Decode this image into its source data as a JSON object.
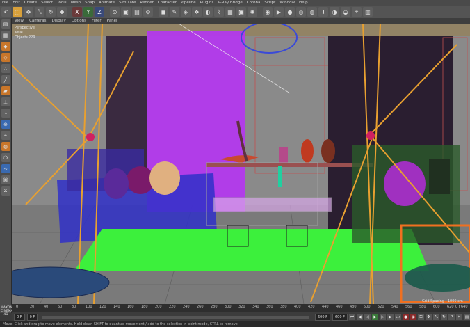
{
  "menu": [
    "File",
    "Edit",
    "Create",
    "Select",
    "Tools",
    "Mesh",
    "Snap",
    "Animate",
    "Simulate",
    "Render",
    "Character",
    "Pipeline",
    "Plugins",
    "V-Ray Bridge",
    "Corona",
    "Script",
    "Window",
    "Help"
  ],
  "toolbar": {
    "icons": [
      "undo-icon",
      "select-icon",
      "move-icon",
      "scale-icon",
      "rotate-icon",
      "add-icon"
    ],
    "axis": [
      "X",
      "Y",
      "Z"
    ]
  },
  "viewport_menu": [
    "View",
    "Cameras",
    "Display",
    "Options",
    "Filter",
    "Panel"
  ],
  "viewport_info": {
    "view_label": "Perspective",
    "total_label": "Total",
    "objects_label": "Objects",
    "objects_count": "229"
  },
  "timeline": {
    "ticks": [
      "0",
      "20",
      "40",
      "60",
      "80",
      "100",
      "120",
      "140",
      "160",
      "180",
      "200",
      "220",
      "240",
      "260",
      "280",
      "300",
      "320",
      "340",
      "360",
      "380",
      "400",
      "420",
      "440",
      "460",
      "480",
      "500",
      "520",
      "540",
      "560",
      "580",
      "600",
      "620",
      "640"
    ],
    "current_frame": "0 F",
    "grid_spacing": "Grid Spacing : 1000 cm"
  },
  "playback": {
    "start": "0 F",
    "min": "0 F",
    "max": "600 F",
    "end": "600 F"
  },
  "logo": {
    "line1": "MAXON",
    "line2": "CINEMA 4D"
  },
  "status": "Move: Click and drag to move elements. Hold down SHIFT to quantize movement / add to the selection in point mode, CTRL to remove.",
  "colors": {
    "wire_purple": "#b436f0",
    "wire_green": "#3cf03c",
    "wire_blue": "#2a2ad8",
    "wire_orange": "#f0a020",
    "floor": "#7a7a7a"
  }
}
